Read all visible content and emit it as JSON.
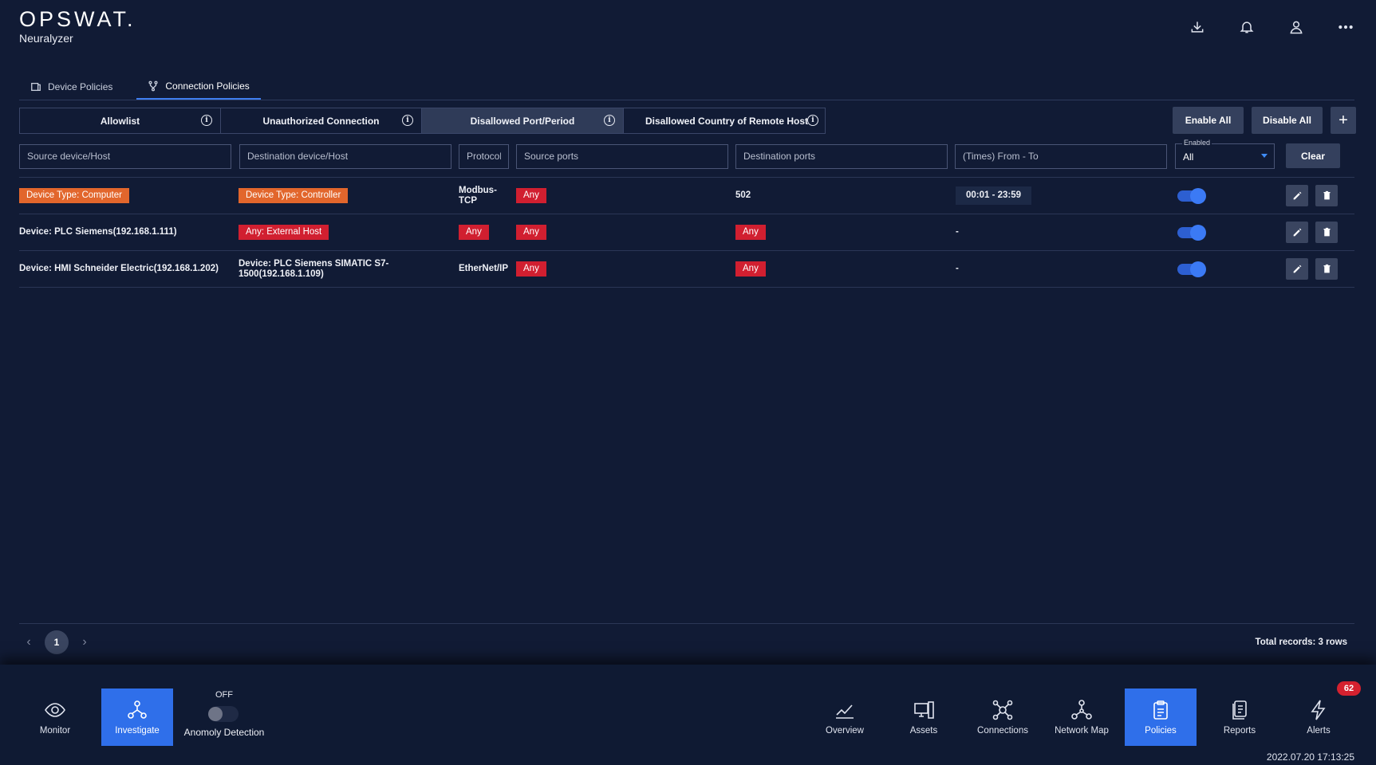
{
  "app": {
    "logo": "OPSWAT.",
    "product": "Neuralyzer"
  },
  "header_icons": [
    "download-icon",
    "bell-icon",
    "user-icon",
    "more-icon"
  ],
  "tabs": [
    {
      "label": "Device Policies",
      "icon": "device-icon",
      "active": false
    },
    {
      "label": "Connection Policies",
      "icon": "connection-icon",
      "active": true
    }
  ],
  "policy_types": [
    {
      "label": "Allowlist",
      "active": false
    },
    {
      "label": "Unauthorized Connection",
      "active": false
    },
    {
      "label": "Disallowed Port/Period",
      "active": true
    },
    {
      "label": "Disallowed Country of Remote Host",
      "active": false
    }
  ],
  "actions": {
    "enable_all": "Enable All",
    "disable_all": "Disable All",
    "add": "+"
  },
  "filters": {
    "source": "Source device/Host",
    "destination": "Destination device/Host",
    "protocol": "Protocol",
    "source_ports": "Source ports",
    "destination_ports": "Destination ports",
    "times": "(Times) From - To",
    "enabled_label": "Enabled",
    "enabled_value": "All",
    "clear": "Clear"
  },
  "rows": [
    {
      "source": "Device Type: Computer",
      "source_tag": "orange",
      "destination": "Device Type: Controller",
      "destination_tag": "orange",
      "protocol": "Modbus-TCP",
      "source_ports": "Any",
      "destination_ports": "502",
      "destination_ports_tag": "",
      "time": "00:01 - 23:59",
      "enabled": true
    },
    {
      "source": "Device: PLC Siemens(192.168.1.111)",
      "source_tag": "",
      "destination": "Any: External Host",
      "destination_tag": "red",
      "protocol": "Any",
      "source_ports": "Any",
      "destination_ports": "Any",
      "destination_ports_tag": "red",
      "time": "-",
      "enabled": true
    },
    {
      "source": "Device: HMI Schneider Electric(192.168.1.202)",
      "source_tag": "",
      "destination": "Device: PLC Siemens SIMATIC S7-1500(192.168.1.109)",
      "destination_tag": "",
      "protocol": "EtherNet/IP",
      "source_ports": "Any",
      "destination_ports": "Any",
      "destination_ports_tag": "red",
      "time": "-",
      "enabled": true
    }
  ],
  "pagination": {
    "prev": "‹",
    "page": "1",
    "next": "›",
    "total": "Total records: 3 rows"
  },
  "bottom_nav": {
    "monitor": "Monitor",
    "investigate": "Investigate",
    "anomaly_state": "OFF",
    "anomaly_label": "Anomoly Detection",
    "overview": "Overview",
    "assets": "Assets",
    "connections": "Connections",
    "network_map": "Network Map",
    "policies": "Policies",
    "reports": "Reports",
    "alerts": "Alerts",
    "alerts_badge": "62"
  },
  "datetime": "2022.07.20 17:13:25",
  "colors": {
    "accent": "#2f6fea",
    "tag_orange": "#e2662c",
    "tag_red": "#d11f30",
    "background": "#111b35"
  }
}
